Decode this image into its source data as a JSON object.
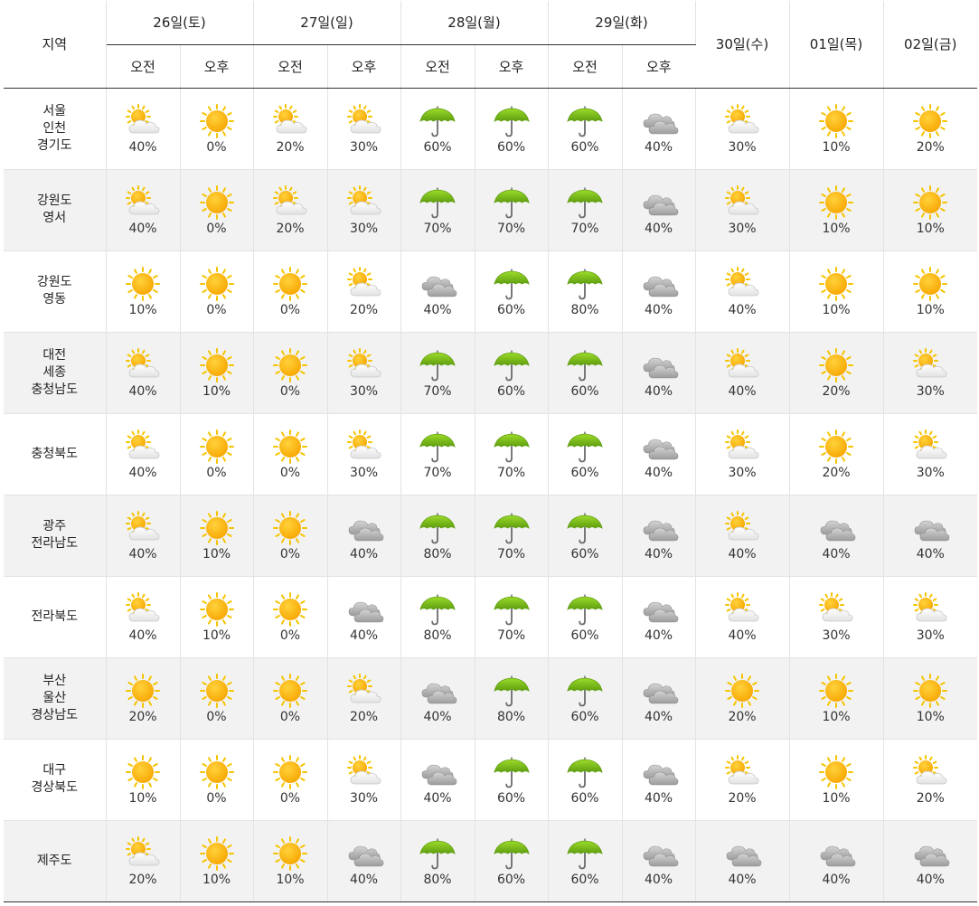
{
  "header": {
    "region_label": "지역",
    "days_split": [
      {
        "label": "26일(토)"
      },
      {
        "label": "27일(일)"
      },
      {
        "label": "28일(월)"
      },
      {
        "label": "29일(화)"
      }
    ],
    "days_single": [
      {
        "label": "30일(수)"
      },
      {
        "label": "01일(목)"
      },
      {
        "label": "02일(금)"
      }
    ],
    "am_label": "오전",
    "pm_label": "오후"
  },
  "rows": [
    {
      "region": [
        "서울",
        "인천",
        "경기도"
      ],
      "cells": [
        {
          "icon": "partly-cloudy",
          "pct": "40%"
        },
        {
          "icon": "sunny",
          "pct": "0%"
        },
        {
          "icon": "partly-cloudy",
          "pct": "20%"
        },
        {
          "icon": "partly-cloudy",
          "pct": "30%"
        },
        {
          "icon": "rain-umbrella",
          "pct": "60%"
        },
        {
          "icon": "rain-umbrella",
          "pct": "60%"
        },
        {
          "icon": "rain-umbrella",
          "pct": "60%"
        },
        {
          "icon": "cloudy",
          "pct": "40%"
        },
        {
          "icon": "partly-cloudy",
          "pct": "30%"
        },
        {
          "icon": "sunny",
          "pct": "10%"
        },
        {
          "icon": "sunny",
          "pct": "20%"
        }
      ]
    },
    {
      "region": [
        "강원도",
        "영서"
      ],
      "cells": [
        {
          "icon": "partly-cloudy",
          "pct": "40%"
        },
        {
          "icon": "sunny",
          "pct": "0%"
        },
        {
          "icon": "partly-cloudy",
          "pct": "20%"
        },
        {
          "icon": "partly-cloudy",
          "pct": "30%"
        },
        {
          "icon": "rain-umbrella",
          "pct": "70%"
        },
        {
          "icon": "rain-umbrella",
          "pct": "70%"
        },
        {
          "icon": "rain-umbrella",
          "pct": "70%"
        },
        {
          "icon": "cloudy",
          "pct": "40%"
        },
        {
          "icon": "partly-cloudy",
          "pct": "30%"
        },
        {
          "icon": "sunny",
          "pct": "10%"
        },
        {
          "icon": "sunny",
          "pct": "10%"
        }
      ]
    },
    {
      "region": [
        "강원도",
        "영동"
      ],
      "cells": [
        {
          "icon": "sunny",
          "pct": "10%"
        },
        {
          "icon": "sunny",
          "pct": "0%"
        },
        {
          "icon": "sunny",
          "pct": "0%"
        },
        {
          "icon": "partly-cloudy",
          "pct": "20%"
        },
        {
          "icon": "cloudy",
          "pct": "40%"
        },
        {
          "icon": "rain-umbrella",
          "pct": "60%"
        },
        {
          "icon": "rain-umbrella",
          "pct": "80%"
        },
        {
          "icon": "cloudy",
          "pct": "40%"
        },
        {
          "icon": "partly-cloudy",
          "pct": "40%"
        },
        {
          "icon": "sunny",
          "pct": "10%"
        },
        {
          "icon": "sunny",
          "pct": "10%"
        }
      ]
    },
    {
      "region": [
        "대전",
        "세종",
        "충청남도"
      ],
      "cells": [
        {
          "icon": "partly-cloudy",
          "pct": "40%"
        },
        {
          "icon": "sunny",
          "pct": "10%"
        },
        {
          "icon": "sunny",
          "pct": "0%"
        },
        {
          "icon": "partly-cloudy",
          "pct": "30%"
        },
        {
          "icon": "rain-umbrella",
          "pct": "70%"
        },
        {
          "icon": "rain-umbrella",
          "pct": "60%"
        },
        {
          "icon": "rain-umbrella",
          "pct": "60%"
        },
        {
          "icon": "cloudy",
          "pct": "40%"
        },
        {
          "icon": "partly-cloudy",
          "pct": "40%"
        },
        {
          "icon": "sunny",
          "pct": "20%"
        },
        {
          "icon": "partly-cloudy",
          "pct": "30%"
        }
      ]
    },
    {
      "region": [
        "충청북도"
      ],
      "cells": [
        {
          "icon": "partly-cloudy",
          "pct": "40%"
        },
        {
          "icon": "sunny",
          "pct": "0%"
        },
        {
          "icon": "sunny",
          "pct": "0%"
        },
        {
          "icon": "partly-cloudy",
          "pct": "30%"
        },
        {
          "icon": "rain-umbrella",
          "pct": "70%"
        },
        {
          "icon": "rain-umbrella",
          "pct": "70%"
        },
        {
          "icon": "rain-umbrella",
          "pct": "60%"
        },
        {
          "icon": "cloudy",
          "pct": "40%"
        },
        {
          "icon": "partly-cloudy",
          "pct": "30%"
        },
        {
          "icon": "sunny",
          "pct": "20%"
        },
        {
          "icon": "partly-cloudy",
          "pct": "30%"
        }
      ]
    },
    {
      "region": [
        "광주",
        "전라남도"
      ],
      "cells": [
        {
          "icon": "partly-cloudy",
          "pct": "40%"
        },
        {
          "icon": "sunny",
          "pct": "10%"
        },
        {
          "icon": "sunny",
          "pct": "0%"
        },
        {
          "icon": "cloudy",
          "pct": "40%"
        },
        {
          "icon": "rain-umbrella",
          "pct": "80%"
        },
        {
          "icon": "rain-umbrella",
          "pct": "70%"
        },
        {
          "icon": "rain-umbrella",
          "pct": "60%"
        },
        {
          "icon": "cloudy",
          "pct": "40%"
        },
        {
          "icon": "partly-cloudy",
          "pct": "40%"
        },
        {
          "icon": "cloudy",
          "pct": "40%"
        },
        {
          "icon": "cloudy",
          "pct": "40%"
        }
      ]
    },
    {
      "region": [
        "전라북도"
      ],
      "cells": [
        {
          "icon": "partly-cloudy",
          "pct": "40%"
        },
        {
          "icon": "sunny",
          "pct": "10%"
        },
        {
          "icon": "sunny",
          "pct": "0%"
        },
        {
          "icon": "cloudy",
          "pct": "40%"
        },
        {
          "icon": "rain-umbrella",
          "pct": "80%"
        },
        {
          "icon": "rain-umbrella",
          "pct": "70%"
        },
        {
          "icon": "rain-umbrella",
          "pct": "60%"
        },
        {
          "icon": "cloudy",
          "pct": "40%"
        },
        {
          "icon": "partly-cloudy",
          "pct": "40%"
        },
        {
          "icon": "partly-cloudy",
          "pct": "30%"
        },
        {
          "icon": "partly-cloudy",
          "pct": "30%"
        }
      ]
    },
    {
      "region": [
        "부산",
        "울산",
        "경상남도"
      ],
      "cells": [
        {
          "icon": "sunny",
          "pct": "20%"
        },
        {
          "icon": "sunny",
          "pct": "0%"
        },
        {
          "icon": "sunny",
          "pct": "0%"
        },
        {
          "icon": "partly-cloudy",
          "pct": "20%"
        },
        {
          "icon": "cloudy",
          "pct": "40%"
        },
        {
          "icon": "rain-umbrella",
          "pct": "80%"
        },
        {
          "icon": "rain-umbrella",
          "pct": "60%"
        },
        {
          "icon": "cloudy",
          "pct": "40%"
        },
        {
          "icon": "sunny",
          "pct": "20%"
        },
        {
          "icon": "sunny",
          "pct": "10%"
        },
        {
          "icon": "sunny",
          "pct": "10%"
        }
      ]
    },
    {
      "region": [
        "대구",
        "경상북도"
      ],
      "cells": [
        {
          "icon": "sunny",
          "pct": "10%"
        },
        {
          "icon": "sunny",
          "pct": "0%"
        },
        {
          "icon": "sunny",
          "pct": "0%"
        },
        {
          "icon": "partly-cloudy",
          "pct": "30%"
        },
        {
          "icon": "cloudy",
          "pct": "40%"
        },
        {
          "icon": "rain-umbrella",
          "pct": "60%"
        },
        {
          "icon": "rain-umbrella",
          "pct": "60%"
        },
        {
          "icon": "cloudy",
          "pct": "40%"
        },
        {
          "icon": "partly-cloudy",
          "pct": "20%"
        },
        {
          "icon": "sunny",
          "pct": "10%"
        },
        {
          "icon": "partly-cloudy",
          "pct": "20%"
        }
      ]
    },
    {
      "region": [
        "제주도"
      ],
      "cells": [
        {
          "icon": "partly-cloudy",
          "pct": "20%"
        },
        {
          "icon": "sunny",
          "pct": "10%"
        },
        {
          "icon": "sunny",
          "pct": "10%"
        },
        {
          "icon": "cloudy",
          "pct": "40%"
        },
        {
          "icon": "rain-umbrella",
          "pct": "80%"
        },
        {
          "icon": "rain-umbrella",
          "pct": "60%"
        },
        {
          "icon": "rain-umbrella",
          "pct": "60%"
        },
        {
          "icon": "cloudy",
          "pct": "40%"
        },
        {
          "icon": "cloudy",
          "pct": "40%"
        },
        {
          "icon": "cloudy",
          "pct": "40%"
        },
        {
          "icon": "cloudy",
          "pct": "40%"
        }
      ]
    }
  ],
  "colors": {
    "sun": "#f7a600",
    "sun_light": "#ffd23c",
    "ray": "#f5c400",
    "cloud_light": "#f2f2f2",
    "cloud_dark": "#a9a9a9",
    "umbrella": "#7cc418",
    "umbrella_dark": "#5f9e10",
    "row_alt_bg": "#f2f2f2"
  }
}
